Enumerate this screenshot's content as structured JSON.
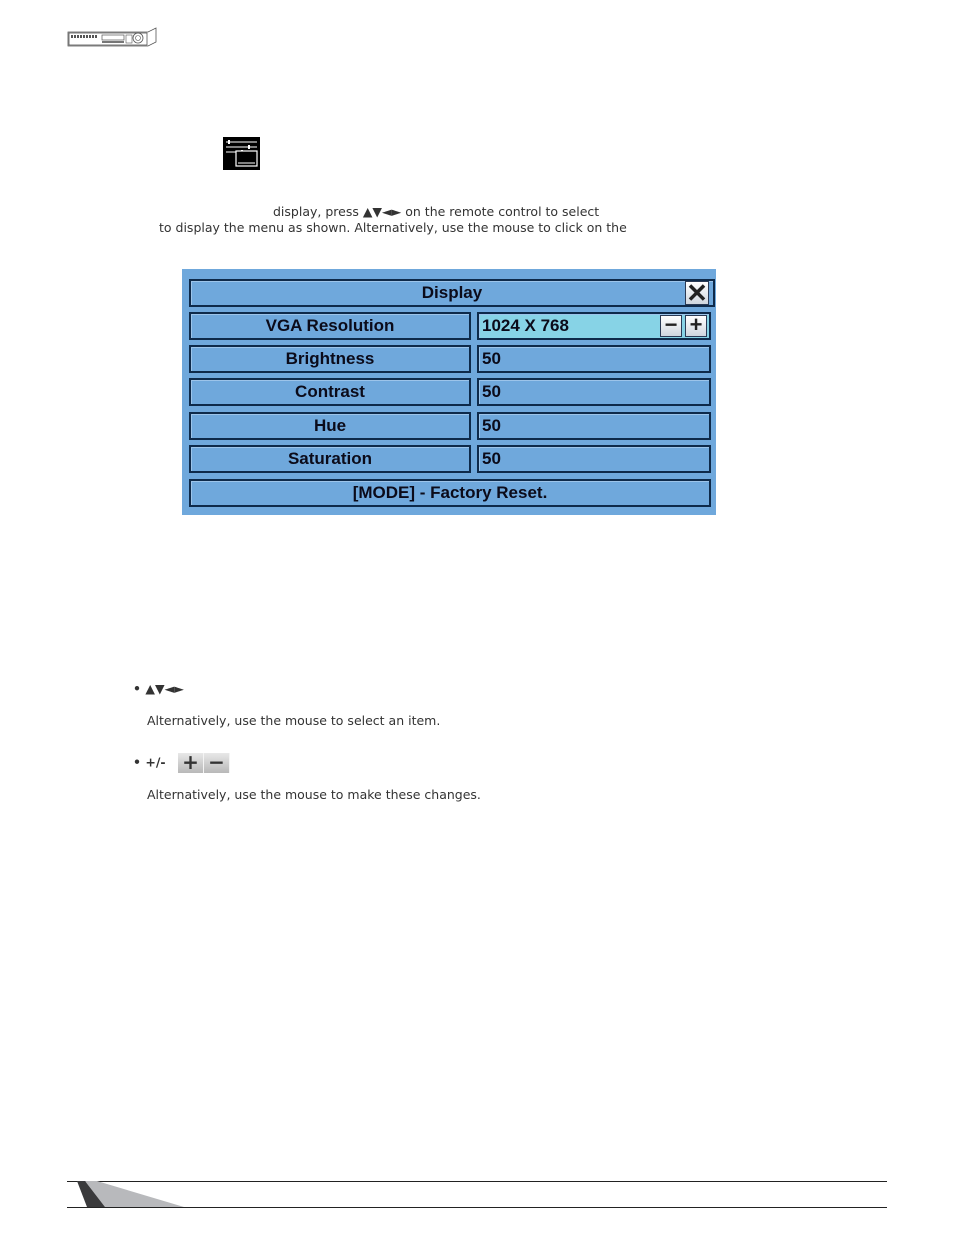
{
  "header": {
    "device_icon": "dvr-front-panel-icon"
  },
  "intro": {
    "menu_icon": "display-menu-icon",
    "line1": "display, press ▲▼◄► on the remote control to select",
    "line2": "to display the menu as shown.   Alternatively, use the mouse to click on the"
  },
  "osd": {
    "title": "Display",
    "close_icon": "close-icon",
    "rows": [
      {
        "label": "VGA Resolution",
        "value": "1024 X 768",
        "selected": true
      },
      {
        "label": "Brightness",
        "value": "50"
      },
      {
        "label": "Contrast",
        "value": "50"
      },
      {
        "label": "Hue",
        "value": "50"
      },
      {
        "label": "Saturation",
        "value": "50"
      }
    ],
    "decrease_label": "−",
    "increase_label": "+",
    "footer": "[MODE] - Factory Reset.",
    "colors": {
      "panel": "#6fa8dc",
      "selected": "#87d3e6",
      "border": "#0e2a4a"
    }
  },
  "instructions": [
    {
      "bullet": "•",
      "keys": "▲▼◄►",
      "text": "Alternatively, use the mouse to select an item."
    },
    {
      "bullet": "•",
      "keys": "+/-",
      "plus": "+",
      "minus": "−",
      "text": "Alternatively, use the mouse to make these changes."
    }
  ]
}
